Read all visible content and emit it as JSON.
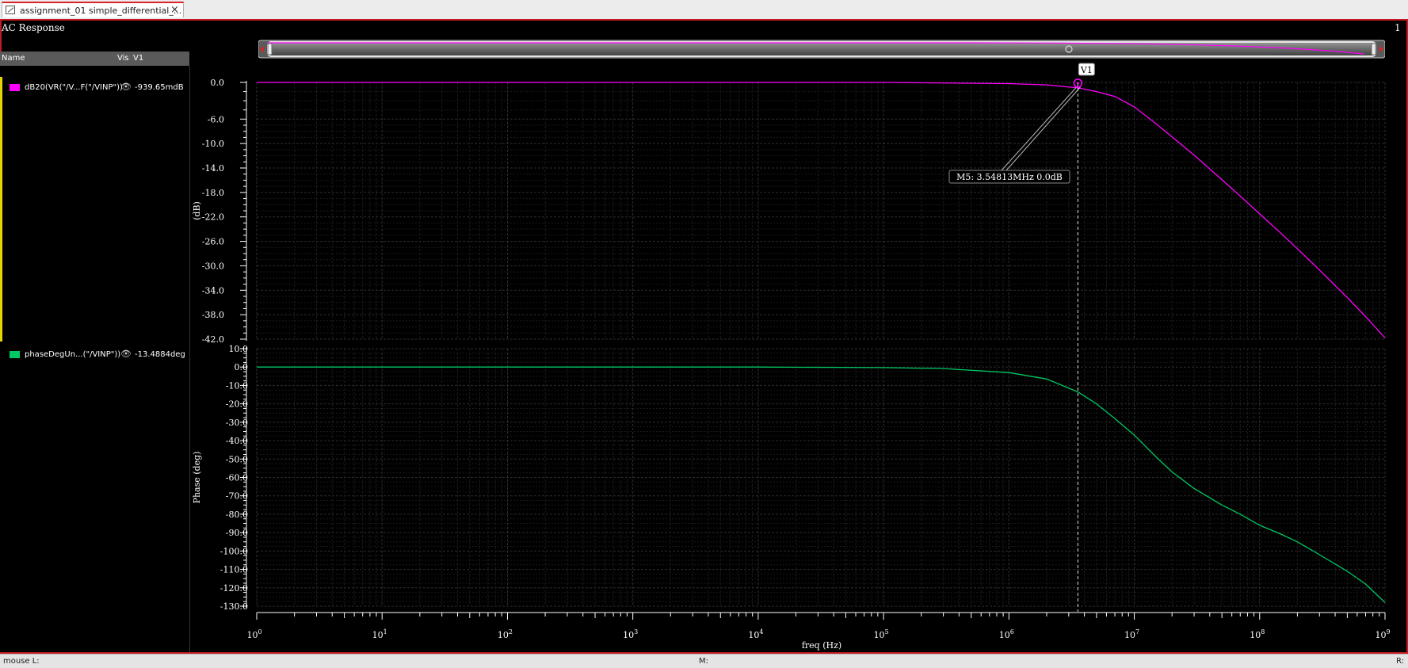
{
  "tab": {
    "title": "assignment_01 simple_differential_...",
    "close": "×",
    "icon": "waveform-window-icon"
  },
  "window": {
    "title": "AC Response",
    "subwindow_index": "1"
  },
  "legend": {
    "header": {
      "name": "Name",
      "vis": "Vis",
      "v1": "V1"
    },
    "traces": [
      {
        "name": "dB20(VR(\"/V...F(\"/VINP\"))",
        "value": "-939.65mdB",
        "color": "#ff00ff",
        "eye": "eye-icon"
      },
      {
        "name": "phaseDegUn...(\"/VINP\"))",
        "value": "-13.4884deg",
        "color": "#00c864",
        "eye": "eye-icon"
      }
    ]
  },
  "colors": {
    "magnitude": "#ff00ff",
    "phase": "#00c864",
    "frame": "#c41a22",
    "grid": "#2e2e2e"
  },
  "marker": {
    "label": "V1",
    "readout": "M5: 3.54813MHz 0.0dB",
    "freq_hz": 3548130,
    "value_db": 0.0
  },
  "statusbar": {
    "left": "mouse L:",
    "middle": "M:",
    "right": "R:"
  },
  "chart_data": [
    {
      "type": "line",
      "title": "",
      "xlabel": "",
      "ylabel": "(dB)",
      "xscale": "log",
      "xlim": [
        1,
        1000000000
      ],
      "ylim": [
        -42,
        0
      ],
      "yticks": [
        0,
        -6,
        -10,
        -14,
        -18,
        -22,
        -26,
        -30,
        -34,
        -38,
        -42
      ],
      "ytick_labels": [
        "0.0",
        "-6.0",
        "-10.0",
        "-14.0",
        "-18.0",
        "-22.0",
        "-26.0",
        "-30.0",
        "-34.0",
        "-38.0",
        "-42.0"
      ],
      "grid": true,
      "series": [
        {
          "name": "dB20(VR(\"/V...F(\"/VINP\"))",
          "x": [
            1,
            10,
            100,
            1000,
            10000,
            100000,
            1000000,
            2000000,
            3548130,
            5000000,
            7000000,
            10000000,
            15000000,
            20000000,
            30000000,
            50000000,
            70000000,
            100000000,
            150000000,
            200000000,
            300000000,
            500000000,
            700000000,
            1000000000
          ],
          "y": [
            0,
            0,
            0,
            0,
            0,
            0,
            -0.2,
            -0.4,
            -0.9,
            -1.5,
            -2.3,
            -4.0,
            -6.8,
            -8.9,
            -11.9,
            -15.9,
            -18.6,
            -21.5,
            -24.8,
            -27.2,
            -30.7,
            -35.2,
            -38.3,
            -41.8
          ]
        }
      ]
    },
    {
      "type": "line",
      "title": "",
      "xlabel": "freq (Hz)",
      "ylabel": "Phase (deg)",
      "xscale": "log",
      "xlim": [
        1,
        1000000000
      ],
      "ylim": [
        -130,
        10
      ],
      "yticks": [
        10,
        0,
        -10,
        -20,
        -30,
        -40,
        -50,
        -60,
        -70,
        -80,
        -90,
        -100,
        -110,
        -120,
        -130
      ],
      "ytick_labels": [
        "10.0",
        "0.0",
        "-10.0",
        "-20.0",
        "-30.0",
        "-40.0",
        "-50.0",
        "-60.0",
        "-70.0",
        "-80.0",
        "-90.0",
        "-100.0",
        "-110.0",
        "-120.0",
        "-130.0"
      ],
      "xtick_labels": [
        {
          "base": "10",
          "exp": "0",
          "value": 1
        },
        {
          "base": "10",
          "exp": "1",
          "value": 10
        },
        {
          "base": "10",
          "exp": "2",
          "value": 100
        },
        {
          "base": "10",
          "exp": "3",
          "value": 1000
        },
        {
          "base": "10",
          "exp": "4",
          "value": 10000
        },
        {
          "base": "10",
          "exp": "5",
          "value": 100000
        },
        {
          "base": "10",
          "exp": "6",
          "value": 1000000
        },
        {
          "base": "10",
          "exp": "7",
          "value": 10000000
        },
        {
          "base": "10",
          "exp": "8",
          "value": 100000000
        },
        {
          "base": "10",
          "exp": "9",
          "value": 1000000000
        }
      ],
      "grid": true,
      "series": [
        {
          "name": "phaseDegUn...(\"/VINP\"))",
          "x": [
            1,
            10,
            100,
            1000,
            10000,
            100000,
            300000,
            1000000,
            2000000,
            3548130,
            5000000,
            7000000,
            10000000,
            15000000,
            20000000,
            30000000,
            50000000,
            70000000,
            100000000,
            150000000,
            200000000,
            300000000,
            500000000,
            700000000,
            1000000000
          ],
          "y": [
            0,
            0,
            0,
            0,
            0,
            -0.3,
            -0.8,
            -3.0,
            -6.5,
            -13.5,
            -20.0,
            -28.0,
            -37.0,
            -49.0,
            -57.0,
            -66.0,
            -75.0,
            -80.0,
            -86.0,
            -91.0,
            -95.0,
            -102.0,
            -111.0,
            -118.0,
            -128.0
          ]
        }
      ]
    }
  ]
}
